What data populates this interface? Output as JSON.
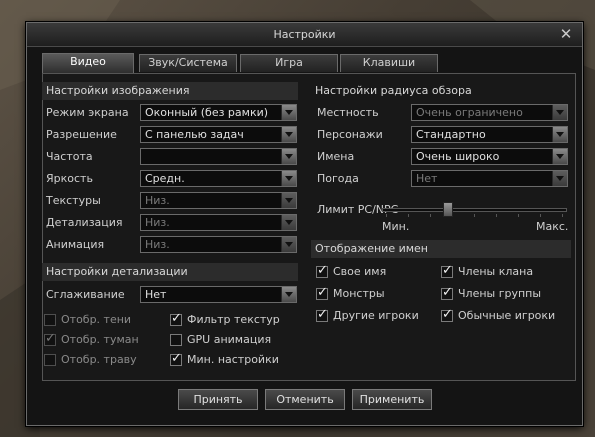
{
  "window": {
    "title": "Настройки",
    "close": "✕"
  },
  "tabs": [
    {
      "label": "Видео",
      "active": true
    },
    {
      "label": "Звук/Система",
      "active": false
    },
    {
      "label": "Игра",
      "active": false
    },
    {
      "label": "Клавиши",
      "active": false
    }
  ],
  "image_settings": {
    "heading": "Настройки изображения",
    "rows": [
      {
        "label": "Режим экрана",
        "value": "Оконный (без рамки)",
        "enabled": true
      },
      {
        "label": "Разрешение",
        "value": "С панелью задач",
        "enabled": true
      },
      {
        "label": "Частота",
        "value": "",
        "enabled": true
      },
      {
        "label": "Яркость",
        "value": "Средн.",
        "enabled": true
      },
      {
        "label": "Текстуры",
        "value": "Низ.",
        "enabled": false
      },
      {
        "label": "Детализация",
        "value": "Низ.",
        "enabled": false
      },
      {
        "label": "Анимация",
        "value": "Низ.",
        "enabled": false
      }
    ]
  },
  "detail_settings": {
    "heading": "Настройки детализации",
    "antialias": {
      "label": "Сглаживание",
      "value": "Нет"
    },
    "checkboxes": [
      {
        "label": "Отобр. тени",
        "checked": false,
        "enabled": false
      },
      {
        "label": "Фильтр текстур",
        "checked": true,
        "enabled": true
      },
      {
        "label": "Отобр. туман",
        "checked": true,
        "enabled": false
      },
      {
        "label": "GPU анимация",
        "checked": false,
        "enabled": true
      },
      {
        "label": "Отобр. траву",
        "checked": false,
        "enabled": false
      },
      {
        "label": "Мин. настройки",
        "checked": true,
        "enabled": true
      }
    ]
  },
  "view_radius": {
    "heading": "Настройки радиуса обзора",
    "rows": [
      {
        "label": "Местность",
        "value": "Очень ограничено",
        "enabled": false
      },
      {
        "label": "Персонажи",
        "value": "Стандартно",
        "enabled": true
      },
      {
        "label": "Имена",
        "value": "Очень широко",
        "enabled": true
      },
      {
        "label": "Погода",
        "value": "Нет",
        "enabled": false
      }
    ],
    "pc_limit": {
      "label": "Лимит PC/NPC",
      "min_label": "Мин.",
      "max_label": "Макс.",
      "level": 0.35
    }
  },
  "name_display": {
    "heading": "Отображение имен",
    "checkboxes": [
      {
        "label": "Свое имя",
        "checked": true
      },
      {
        "label": "Члены клана",
        "checked": true
      },
      {
        "label": "Монстры",
        "checked": true
      },
      {
        "label": "Члены группы",
        "checked": true
      },
      {
        "label": "Другие игроки",
        "checked": true
      },
      {
        "label": "Обычные игроки",
        "checked": true
      }
    ]
  },
  "buttons": {
    "accept": "Принять",
    "cancel": "Отменить",
    "apply": "Применить"
  },
  "icons": {
    "close": "close-icon",
    "dropdown": "chevron-down-icon",
    "check": "check-icon"
  }
}
